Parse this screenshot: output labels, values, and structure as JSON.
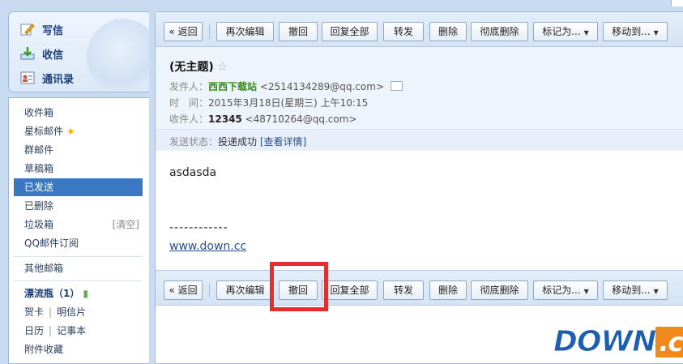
{
  "sidebar": {
    "compose": "写信",
    "receive": "收信",
    "contacts": "通讯录",
    "folders": {
      "inbox": "收件箱",
      "starred": "星标邮件",
      "groups": "群邮件",
      "drafts": "草稿箱",
      "sent": "已发送",
      "deleted": "已删除",
      "spam": "垃圾箱",
      "spam_clean": "[清空]",
      "subscriptions": "QQ邮件订阅",
      "other": "其他邮箱",
      "drift_bottle": "漂流瓶（1）",
      "cards": "贺卡",
      "postcards": "明信片",
      "calendar": "日历",
      "notes": "记事本",
      "attachments": "附件收藏"
    }
  },
  "toolbar": {
    "back": "« 返回",
    "reedit": "再次编辑",
    "recall": "撤回",
    "reply_all": "回复全部",
    "forward": "转发",
    "delete": "删除",
    "delete_perm": "彻底删除",
    "mark_as": "标记为...",
    "move_to": "移动到..."
  },
  "mail": {
    "subject": "(无主题)",
    "from_label": "发件人：",
    "from_name": "西西下载站",
    "from_addr": "<2514134289@qq.com>",
    "time_label": "时　间：",
    "time_value": "2015年3月18日(星期三) 上午10:15",
    "to_label": "收件人：",
    "to_name": "12345",
    "to_addr": "<48710264@qq.com>",
    "status_label": "发送状态：",
    "status_value": "投递成功",
    "status_link": "[查看详情]",
    "body": "asdasda",
    "signature_dashes": "------------",
    "signature_link": "www.down.cc"
  },
  "logo": {
    "main": "DOWN",
    "suffix": ".cc"
  },
  "colors": {
    "highlight": "#e52e2e",
    "active_folder": "#3b78c3",
    "sender": "#3a8a1e"
  }
}
